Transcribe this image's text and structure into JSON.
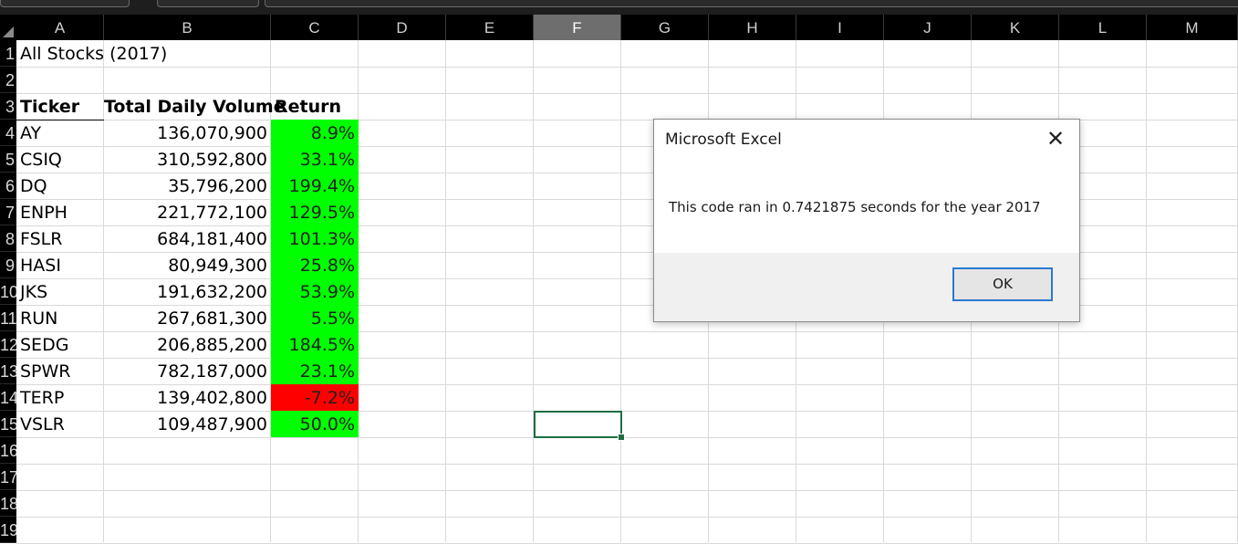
{
  "columns": [
    "A",
    "B",
    "C",
    "D",
    "E",
    "F",
    "G",
    "H",
    "I",
    "J",
    "K",
    "L",
    "M"
  ],
  "selected_column": "F",
  "rows": [
    "1",
    "2",
    "3",
    "4",
    "5",
    "6",
    "7",
    "8",
    "9",
    "10",
    "11",
    "12",
    "13",
    "14",
    "15",
    "16",
    "17",
    "18",
    "19"
  ],
  "sheet": {
    "title": "All Stocks (2017)",
    "headers": {
      "ticker": "Ticker",
      "volume": "Total Daily Volume",
      "return": "Return"
    },
    "data": [
      {
        "ticker": "AY",
        "volume": "136,070,900",
        "return": "8.9%",
        "positive": true
      },
      {
        "ticker": "CSIQ",
        "volume": "310,592,800",
        "return": "33.1%",
        "positive": true
      },
      {
        "ticker": "DQ",
        "volume": "35,796,200",
        "return": "199.4%",
        "positive": true
      },
      {
        "ticker": "ENPH",
        "volume": "221,772,100",
        "return": "129.5%",
        "positive": true
      },
      {
        "ticker": "FSLR",
        "volume": "684,181,400",
        "return": "101.3%",
        "positive": true
      },
      {
        "ticker": "HASI",
        "volume": "80,949,300",
        "return": "25.8%",
        "positive": true
      },
      {
        "ticker": "JKS",
        "volume": "191,632,200",
        "return": "53.9%",
        "positive": true
      },
      {
        "ticker": "RUN",
        "volume": "267,681,300",
        "return": "5.5%",
        "positive": true
      },
      {
        "ticker": "SEDG",
        "volume": "206,885,200",
        "return": "184.5%",
        "positive": true
      },
      {
        "ticker": "SPWR",
        "volume": "782,187,000",
        "return": "23.1%",
        "positive": true
      },
      {
        "ticker": "TERP",
        "volume": "139,402,800",
        "return": "-7.2%",
        "positive": false
      },
      {
        "ticker": "VSLR",
        "volume": "109,487,900",
        "return": "50.0%",
        "positive": true
      }
    ]
  },
  "colors": {
    "positive": "#00ff00",
    "negative": "#ff0000",
    "selection": "#1e6e42"
  },
  "dialog": {
    "title": "Microsoft Excel",
    "message": "This code ran in 0.7421875 seconds for the year 2017",
    "ok_label": "OK",
    "close_icon": "close-icon"
  }
}
